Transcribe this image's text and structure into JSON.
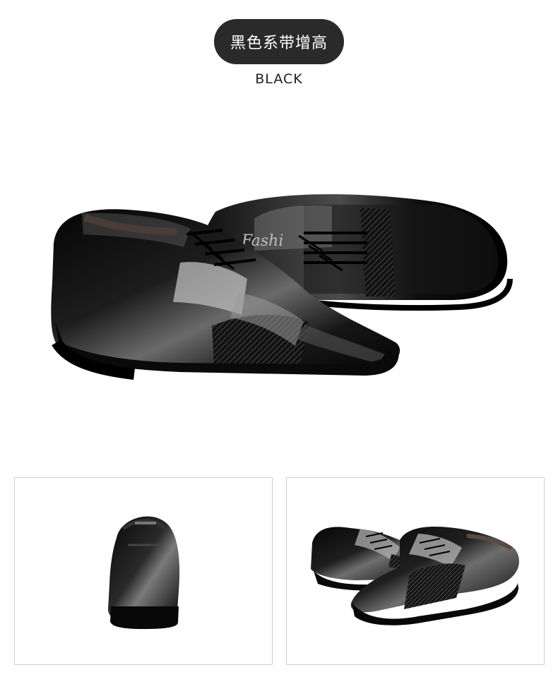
{
  "header": {
    "title": "黑色系带增高",
    "subtitle": "BLACK"
  },
  "hero": {
    "label": "Fashi"
  },
  "colors": {
    "pill_bg": "#2a2a2a",
    "shoe_black": "#111111",
    "shoe_shine": "#8c8c8c",
    "border": "#cfcfcf"
  },
  "thumbnails": [
    {
      "view": "back"
    },
    {
      "view": "pair"
    }
  ]
}
